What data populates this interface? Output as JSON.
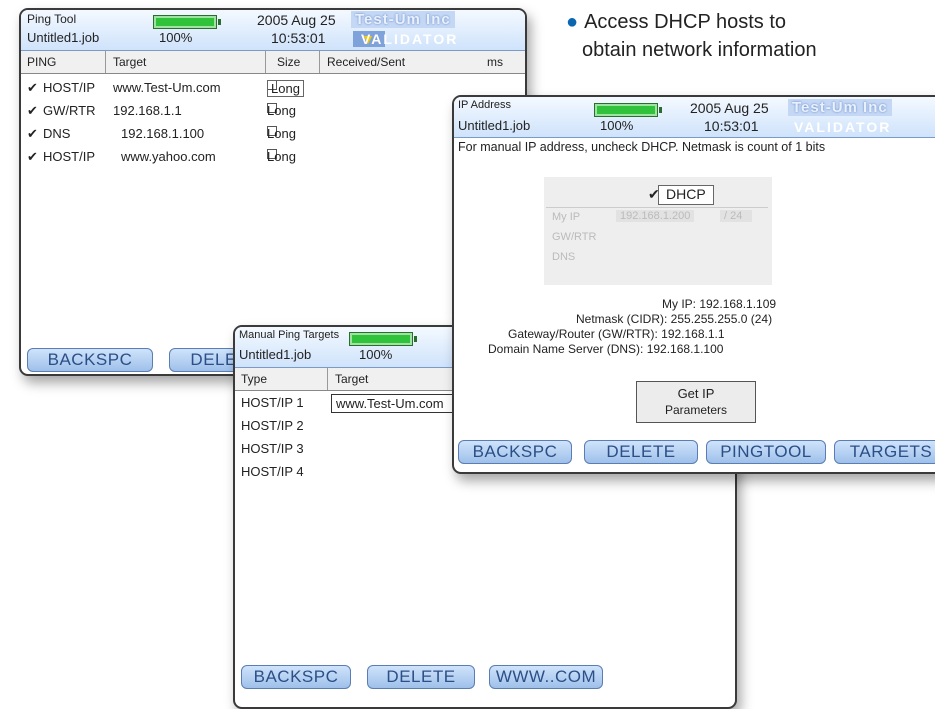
{
  "bullet": {
    "line1": "Access DHCP hosts to",
    "line2": "obtain network information"
  },
  "ping_tool": {
    "title": "Ping Tool",
    "job": "Untitled1.job",
    "battery": "100%",
    "date": "2005 Aug 25",
    "time": "10:53:01",
    "brand": "Test-Um Inc",
    "product": "VALIDATOR",
    "columns": [
      "PING",
      "Target",
      "Size",
      "Received/Sent",
      "ms"
    ],
    "rows": [
      {
        "type": "HOST/IP",
        "target": "www.Test-Um.com",
        "size": "Long"
      },
      {
        "type": "GW/RTR",
        "target": "192.168.1.1",
        "size": "Long"
      },
      {
        "type": "DNS",
        "target": "192.168.1.100",
        "size": "Long"
      },
      {
        "type": "HOST/IP",
        "target": "www.yahoo.com",
        "size": "Long"
      }
    ],
    "buttons": [
      "BACKSPC",
      "DELETE"
    ]
  },
  "manual_ping": {
    "title": "Manual Ping Targets",
    "job": "Untitled1.job",
    "battery": "100%",
    "columns": [
      "Type",
      "Target"
    ],
    "rows": [
      {
        "type": "HOST/IP 1",
        "target": "www.Test-Um.com"
      },
      {
        "type": "HOST/IP 2",
        "target": ""
      },
      {
        "type": "HOST/IP 3",
        "target": ""
      },
      {
        "type": "HOST/IP 4",
        "target": ""
      }
    ],
    "buttons": [
      "BACKSPC",
      "DELETE",
      "WWW..COM"
    ]
  },
  "ip_address": {
    "title": "IP Address",
    "job": "Untitled1.job",
    "battery": "100%",
    "date": "2005 Aug 25",
    "time": "10:53:01",
    "brand": "Test-Um Inc",
    "product": "VALIDATOR",
    "instruction": "For manual IP address, uncheck DHCP. Netmask is count of 1 bits",
    "dhcp_label": "DHCP",
    "my_ip_label": "My IP",
    "my_ip_value": "192.168.1.200",
    "mask_value": "/ 24",
    "gwrtr_label": "GW/RTR",
    "dns_label": "DNS",
    "info": {
      "my_ip": "My IP: 192.168.1.109",
      "netmask": "Netmask (CIDR): 255.255.255.0 (24)",
      "gateway": "Gateway/Router (GW/RTR): 192.168.1.1",
      "dns": "Domain Name Server (DNS): 192.168.1.100"
    },
    "get_ip_line1": "Get IP",
    "get_ip_line2": "Parameters",
    "buttons": [
      "BACKSPC",
      "DELETE",
      "PINGTOOL",
      "TARGETS"
    ]
  }
}
